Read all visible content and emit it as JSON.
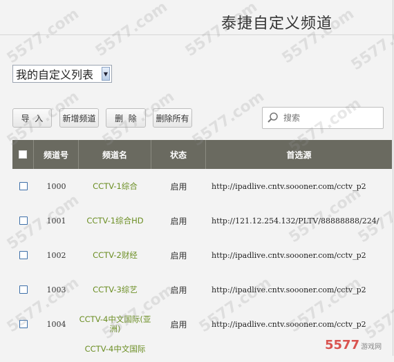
{
  "header": {
    "title": "泰捷自定义频道"
  },
  "list_select": {
    "value": "我的自定义列表"
  },
  "toolbar": {
    "import_label": "导  入",
    "add_label": "新增频道",
    "delete_label": "删  除",
    "delete_all_label": "删除所有"
  },
  "search": {
    "placeholder": "搜索"
  },
  "table": {
    "headers": [
      "频道号",
      "频道名",
      "状态",
      "首选源"
    ],
    "rows": [
      {
        "num": "1000",
        "name": "CCTV-1综合",
        "status": "启用",
        "source": "http://ipadlive.cntv.soooner.com/cctv_p2"
      },
      {
        "num": "1001",
        "name": "CCTV-1综合HD",
        "status": "启用",
        "source": "http://121.12.254.132/PLTV/88888888/224/"
      },
      {
        "num": "1002",
        "name": "CCTV-2财经",
        "status": "启用",
        "source": "http://ipadlive.cntv.soooner.com/cctv_p2"
      },
      {
        "num": "1003",
        "name": "CCTV-3综艺",
        "status": "启用",
        "source": "http://ipadlive.cntv.soooner.com/cctv_p2"
      },
      {
        "num": "1004",
        "name": "CCTV-4中文国际(亚洲)",
        "status": "启用",
        "source": "http://ipadlive.cntv.soooner.com/cctv_p2"
      },
      {
        "num": "",
        "name": "CCTV-4中文国际",
        "status": "",
        "source": ""
      }
    ]
  },
  "watermark": {
    "text": "5577.com"
  },
  "corner_logo": {
    "text": "5577",
    "sub": "游戏网"
  }
}
